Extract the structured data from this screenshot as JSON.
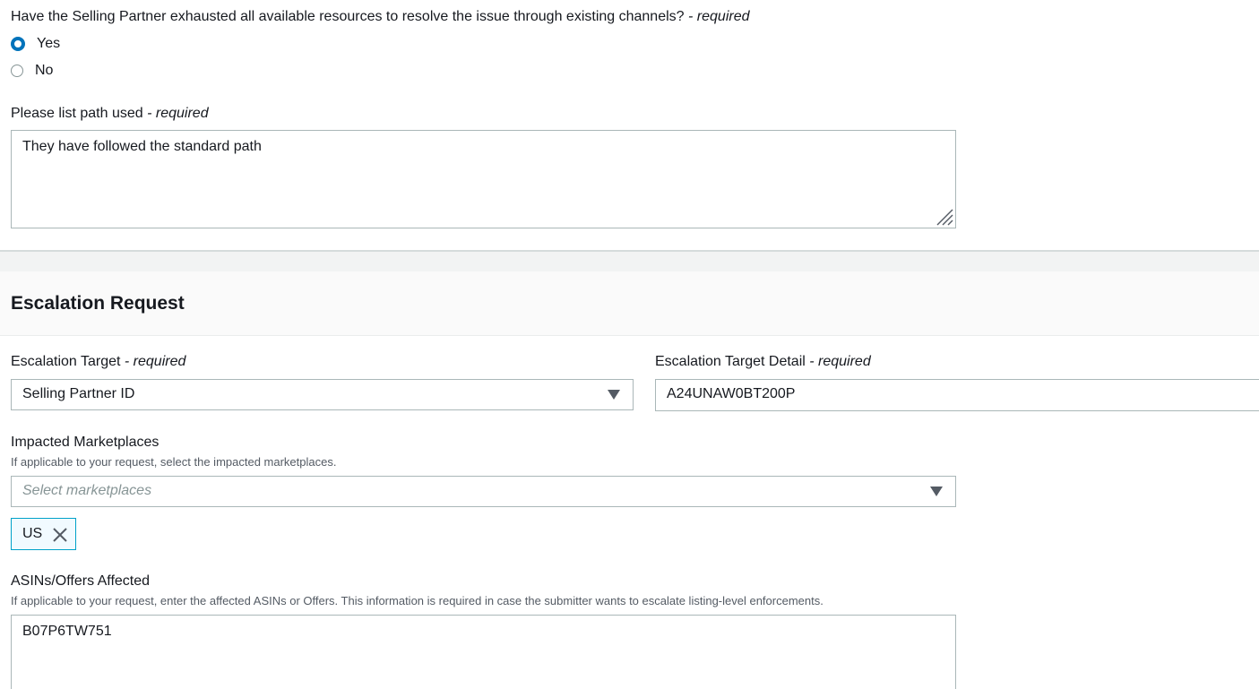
{
  "exhausted_question": {
    "label": "Have the Selling Partner exhausted all available resources to resolve the issue through existing channels?",
    "required_suffix": "- required",
    "options": [
      {
        "label": "Yes",
        "checked": true
      },
      {
        "label": "No",
        "checked": false
      }
    ]
  },
  "path_used": {
    "label": "Please list path used",
    "required_suffix": "- required",
    "value": "They have followed the standard path"
  },
  "section": {
    "title": "Escalation Request"
  },
  "escalation_target": {
    "label": "Escalation Target",
    "required_suffix": "- required",
    "selected": "Selling Partner ID"
  },
  "escalation_target_detail": {
    "label": "Escalation Target Detail",
    "required_suffix": "- required",
    "value": "A24UNAW0BT200P"
  },
  "impacted_marketplaces": {
    "label": "Impacted Marketplaces",
    "hint": "If applicable to your request, select the impacted marketplaces.",
    "placeholder": "Select marketplaces",
    "tokens": [
      "US"
    ]
  },
  "asins_affected": {
    "label": "ASINs/Offers Affected",
    "hint": "If applicable to your request, enter the affected ASINs or Offers. This information is required in case the submitter wants to escalate listing-level enforcements.",
    "value": "B07P6TW751"
  },
  "colors": {
    "accent": "#0073bb",
    "token_border": "#00a1c9",
    "token_bg": "#f1faff",
    "border": "#aab7b8"
  }
}
